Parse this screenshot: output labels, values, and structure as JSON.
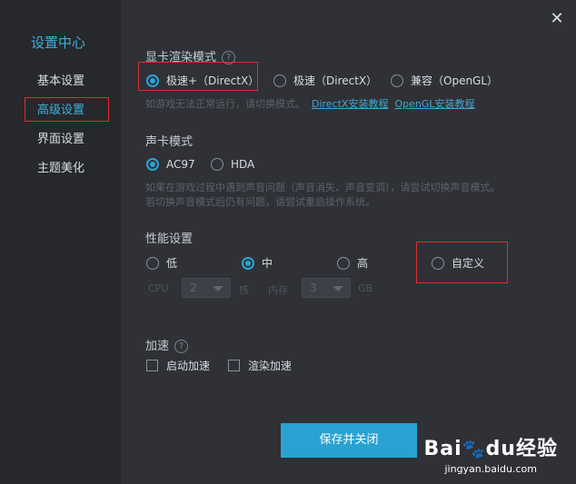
{
  "sidebar": {
    "title": "设置中心",
    "items": [
      {
        "label": "基本设置"
      },
      {
        "label": "高级设置"
      },
      {
        "label": "界面设置"
      },
      {
        "label": "主题美化"
      }
    ]
  },
  "close_label": "✕",
  "graphics": {
    "title": "显卡渲染模式",
    "help": "?",
    "options": [
      {
        "label": "极速+（DirectX）",
        "checked": true
      },
      {
        "label": "极速（DirectX）",
        "checked": false
      },
      {
        "label": "兼容（OpenGL）",
        "checked": false
      }
    ],
    "hint": "如游戏无法正常运行，请切换模式。",
    "link_directx": "DirectX安装教程",
    "link_opengl": "OpenGL安装教程"
  },
  "sound": {
    "title": "声卡模式",
    "options": [
      {
        "label": "AC97",
        "checked": true
      },
      {
        "label": "HDA",
        "checked": false
      }
    ],
    "hint_line1": "如果在游戏过程中遇到声音问题（声音消失、声音变调），请尝试切换声音模式。",
    "hint_line2": "若切换声音模式后仍有问题，请尝试重启操作系统。"
  },
  "performance": {
    "title": "性能设置",
    "options": [
      {
        "label": "低",
        "checked": false
      },
      {
        "label": "中",
        "checked": true
      },
      {
        "label": "高",
        "checked": false
      },
      {
        "label": "自定义",
        "checked": false
      }
    ],
    "cpu_label": "CPU",
    "cpu_value": "2",
    "cpu_unit": "核",
    "mem_label": "内存",
    "mem_value": "3",
    "mem_unit": "GB"
  },
  "accel": {
    "title": "加速",
    "help": "?",
    "options": [
      {
        "label": "启动加速",
        "checked": false
      },
      {
        "label": "渲染加速",
        "checked": false
      }
    ]
  },
  "save_label": "保存并关闭",
  "watermark": {
    "logo": "Bai",
    "logo_paw": "🐾",
    "logo_du": "du",
    "logo_cn": "经验",
    "url": "jingyan.baidu.com"
  },
  "colors": {
    "accent": "#29a2d2",
    "highlight_box": "#d9302e"
  }
}
